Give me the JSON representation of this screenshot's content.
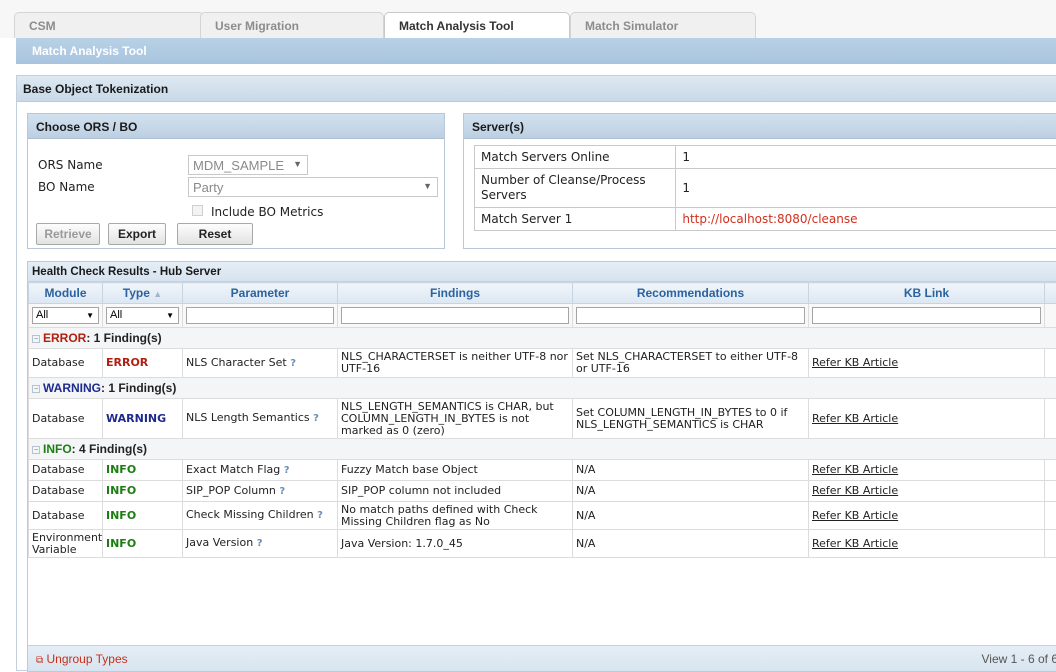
{
  "tabs": [
    "CSM",
    "User Migration",
    "Match Analysis Tool",
    "Match Simulator"
  ],
  "active_tab": "Match Analysis Tool",
  "sub_title": "Match Analysis Tool",
  "section_title": "Base Object Tokenization",
  "choose": {
    "title": "Choose ORS / BO",
    "ors_label": "ORS Name",
    "ors_value": "MDM_SAMPLE",
    "bo_label": "BO Name",
    "bo_value": "Party",
    "include_metrics": "Include BO Metrics",
    "retrieve": "Retrieve",
    "export": "Export",
    "reset": "Reset"
  },
  "servers": {
    "title": "Server(s)",
    "rows": [
      {
        "label": "Match Servers Online",
        "value": "1"
      },
      {
        "label": "Number of Cleanse/Process Servers",
        "value": "1"
      },
      {
        "label": "Match Server 1",
        "value": "http://localhost:8080/cleanse"
      }
    ]
  },
  "health": {
    "caption": "Health Check Results - Hub Server",
    "columns": [
      "Module",
      "Type",
      "Parameter",
      "Findings",
      "Recommendations",
      "KB Link"
    ],
    "filter_module": "All",
    "filter_type": "All",
    "groups": [
      {
        "label": "ERROR",
        "count_text": ": 1 Finding(s)",
        "rows": [
          {
            "module": "Database",
            "type": "ERROR",
            "parameter": "NLS Character Set",
            "findings": "NLS_CHARACTERSET is neither UTF-8 nor UTF-16",
            "recommendations": "Set NLS_CHARACTERSET to either UTF-8 or UTF-16",
            "kb": "Refer KB Article"
          }
        ]
      },
      {
        "label": "WARNING",
        "count_text": ": 1 Finding(s)",
        "rows": [
          {
            "module": "Database",
            "type": "WARNING",
            "parameter": "NLS Length Semantics",
            "findings": "NLS_LENGTH_SEMANTICS is CHAR, but COLUMN_LENGTH_IN_BYTES is not marked as 0 (zero)",
            "recommendations": "Set COLUMN_LENGTH_IN_BYTES to 0 if NLS_LENGTH_SEMANTICS is CHAR",
            "kb": "Refer KB Article"
          }
        ]
      },
      {
        "label": "INFO",
        "count_text": ": 4 Finding(s)",
        "rows": [
          {
            "module": "Database",
            "type": "INFO",
            "parameter": "Exact Match Flag",
            "findings": "Fuzzy Match base Object",
            "recommendations": "N/A",
            "kb": "Refer KB Article"
          },
          {
            "module": "Database",
            "type": "INFO",
            "parameter": "SIP_POP Column",
            "findings": "SIP_POP column not included",
            "recommendations": "N/A",
            "kb": "Refer KB Article"
          },
          {
            "module": "Database",
            "type": "INFO",
            "parameter": "Check Missing Children",
            "findings": "No match paths defined with Check Missing Children flag as No",
            "recommendations": "N/A",
            "kb": "Refer KB Article"
          },
          {
            "module": "Environment Variable",
            "type": "INFO",
            "parameter": "Java Version",
            "findings": "Java Version: 1.7.0_45",
            "recommendations": "N/A",
            "kb": "Refer KB Article"
          }
        ]
      }
    ],
    "ungroup": "Ungroup Types",
    "view_text": "View 1 - 6 of 6"
  },
  "icons": {
    "help": "question-mark-icon",
    "collapse": "minus-icon",
    "sort": "sort-asc-icon",
    "ungroup": "ungroup-icon"
  }
}
